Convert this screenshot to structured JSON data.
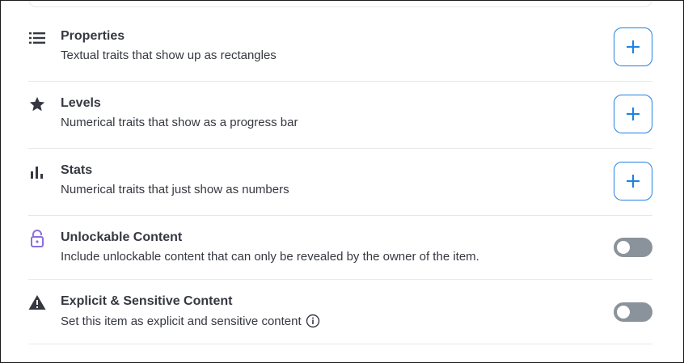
{
  "colors": {
    "text": "#353840",
    "accent": "#2081e2",
    "divider": "#e5e8eb",
    "toggle_off": "#8a939b",
    "lock_icon": "#8c6ee0"
  },
  "rows": [
    {
      "icon": "list-icon",
      "title": "Properties",
      "description": "Textual traits that show up as rectangles",
      "control": "add-button"
    },
    {
      "icon": "star-icon",
      "title": "Levels",
      "description": "Numerical traits that show as a progress bar",
      "control": "add-button"
    },
    {
      "icon": "bar-chart-icon",
      "title": "Stats",
      "description": "Numerical traits that just show as numbers",
      "control": "add-button"
    },
    {
      "icon": "lock-open-icon",
      "title": "Unlockable Content",
      "description": "Include unlockable content that can only be revealed by the owner of the item.",
      "control": "toggle",
      "toggle_on": false
    },
    {
      "icon": "warning-icon",
      "title": "Explicit & Sensitive Content",
      "description": "Set this item as explicit and sensitive content",
      "control": "toggle",
      "toggle_on": false,
      "has_info_icon": true
    }
  ]
}
